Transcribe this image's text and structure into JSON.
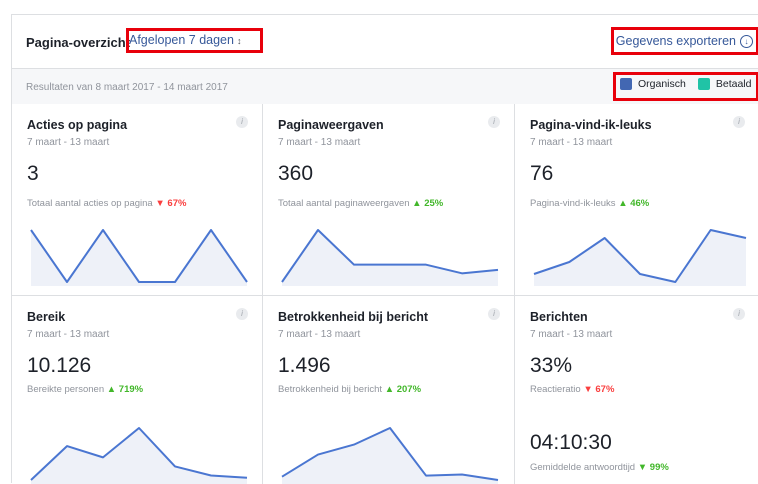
{
  "header": {
    "title": "Pagina-overzicht",
    "range": "Afgelopen 7 dagen",
    "range_arrow": "↕",
    "export": "Gegevens exporteren",
    "export_icon": "↓"
  },
  "subbar": {
    "results_prefix": "Resultaten van ",
    "date_from": "8 maart 2017",
    "results_mid": " - ",
    "date_to": "14 maart 2017",
    "legend": [
      {
        "label": "Organisch",
        "color": "#4267b2"
      },
      {
        "label": "Betaald",
        "color": "#20c3a6"
      }
    ]
  },
  "info_glyph": "i",
  "cards": [
    {
      "title": "Acties op pagina",
      "date": "7 maart - 13 maart",
      "value": "3",
      "desc": "Totaal aantal acties op pagina",
      "trend": "down",
      "trend_glyph": "▼",
      "change": "67%",
      "series": [
        2,
        0,
        2,
        0,
        0,
        2,
        0
      ]
    },
    {
      "title": "Paginaweergaven",
      "date": "7 maart - 13 maart",
      "value": "360",
      "desc": "Totaal aantal paginaweergaven",
      "trend": "up",
      "trend_glyph": "▲",
      "change": "25%",
      "series": [
        45,
        75,
        55,
        55,
        55,
        50,
        52
      ]
    },
    {
      "title": "Pagina-vind-ik-leuks",
      "date": "7 maart - 13 maart",
      "value": "76",
      "desc": "Pagina-vind-ik-leuks",
      "trend": "up",
      "trend_glyph": "▲",
      "change": "46%",
      "series": [
        8,
        11,
        17,
        8,
        6,
        19,
        17
      ]
    },
    {
      "title": "Bereik",
      "date": "7 maart - 13 maart",
      "value": "10.126",
      "desc": "Bereikte personen",
      "trend": "up",
      "trend_glyph": "▲",
      "change": "719%",
      "series": [
        2,
        17,
        12,
        25,
        8,
        4,
        3
      ]
    },
    {
      "title": "Betrokkenheid bij bericht",
      "date": "7 maart - 13 maart",
      "value": "1.496",
      "desc": "Betrokkenheid bij bericht",
      "trend": "up",
      "trend_glyph": "▲",
      "change": "207%",
      "series": [
        50,
        250,
        340,
        490,
        60,
        70,
        20
      ]
    },
    {
      "title": "Berichten",
      "date": "7 maart - 13 maart",
      "value": "33%",
      "desc": "Reactieratio",
      "trend": "down",
      "trend_glyph": "▼",
      "change": "67%",
      "value2": "04:10:30",
      "desc2": "Gemiddelde antwoordtijd",
      "trend2_glyph": "▼",
      "change2": "99%"
    }
  ]
}
